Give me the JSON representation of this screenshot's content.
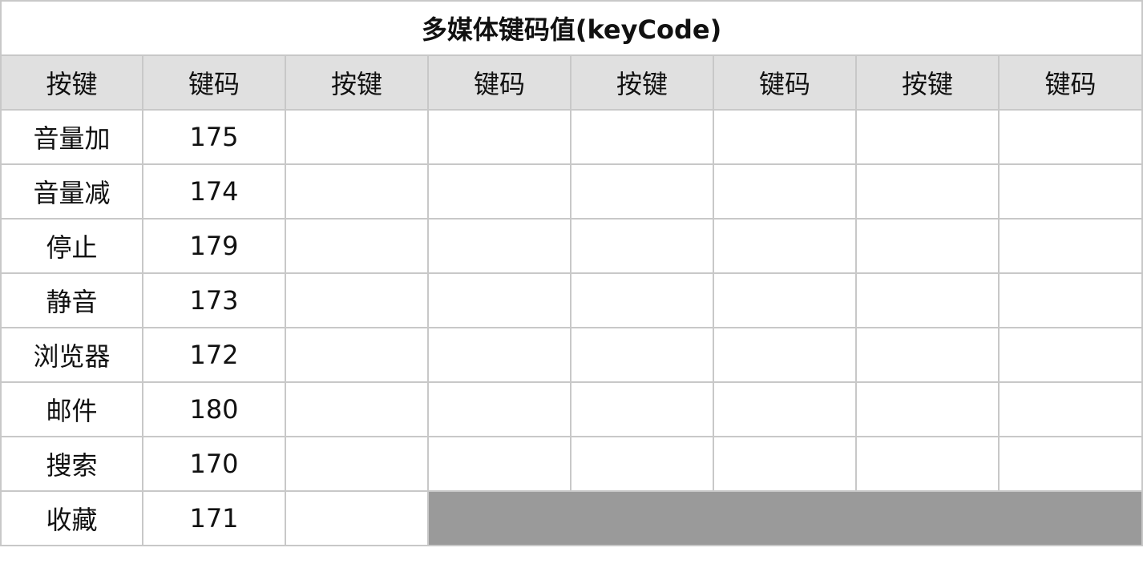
{
  "table": {
    "title": "多媒体键码值(keyCode)",
    "headers": [
      "按键",
      "键码",
      "按键",
      "键码",
      "按键",
      "键码",
      "按键",
      "键码"
    ],
    "rows": [
      {
        "key": "音量加",
        "code": "175"
      },
      {
        "key": "音量减",
        "code": "174"
      },
      {
        "key": "停止",
        "code": "179"
      },
      {
        "key": "静音",
        "code": "173"
      },
      {
        "key": "浏览器",
        "code": "172"
      },
      {
        "key": "邮件",
        "code": "180"
      },
      {
        "key": "搜索",
        "code": "170"
      },
      {
        "key": "收藏",
        "code": "171"
      }
    ]
  },
  "colors": {
    "header_bg": "#e0e0e0",
    "filler_bg": "#9a9a9a",
    "border": "#c8c8c8"
  }
}
